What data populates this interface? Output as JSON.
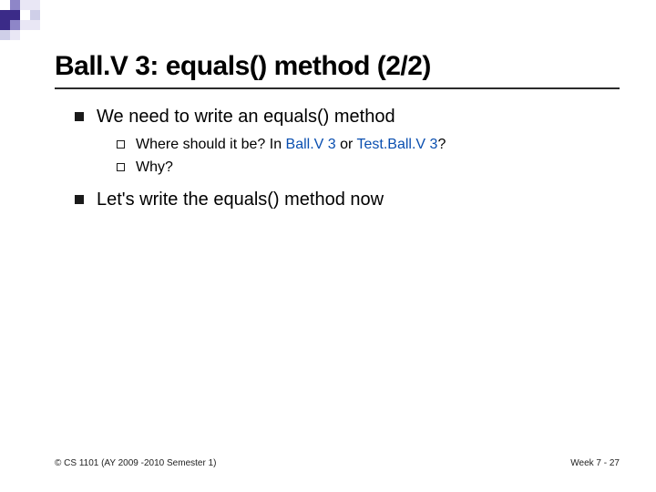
{
  "title": "Ball.V 3: equals() method (2/2)",
  "bullets": {
    "b1": "We need to write an equals() method",
    "b1_1_pre": "Where should it be? In ",
    "b1_1_blue1": "Ball.V 3",
    "b1_1_mid": " or ",
    "b1_1_blue2": "Test.Ball.V 3",
    "b1_1_post": "?",
    "b1_2": "Why?",
    "b2": "Let's write the equals() method now"
  },
  "footer": {
    "left": "© CS 1101 (AY 2009 -2010 Semester 1)",
    "right": "Week 7 - 27"
  }
}
